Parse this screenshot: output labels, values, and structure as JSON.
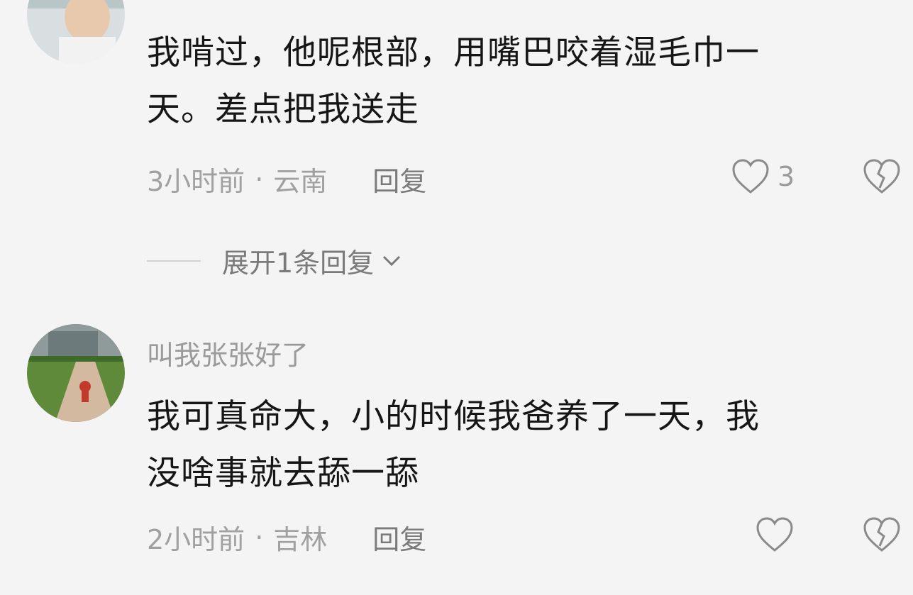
{
  "comments": [
    {
      "username": "",
      "text_lines": [
        "我啃过，他呢根部，用嘴巴咬着湿毛巾一",
        "天。差点把我送走"
      ],
      "time": "3小时前",
      "location": "云南",
      "reply_label": "回复",
      "likes": "3",
      "expand_label": "展开1条回复"
    },
    {
      "username": "叫我张张好了",
      "text_lines": [
        "我可真命大，小的时候我爸养了一天，我",
        "没啥事就去舔一舔"
      ],
      "time": "2小时前",
      "location": "吉林",
      "reply_label": "回复",
      "likes": ""
    }
  ],
  "icons": {
    "like": "heart-outline-icon",
    "dislike": "broken-heart-icon",
    "expand": "chevron-down-icon"
  },
  "colors": {
    "background": "#f4f4f4",
    "text": "#161616",
    "meta": "#a0a0a0"
  }
}
